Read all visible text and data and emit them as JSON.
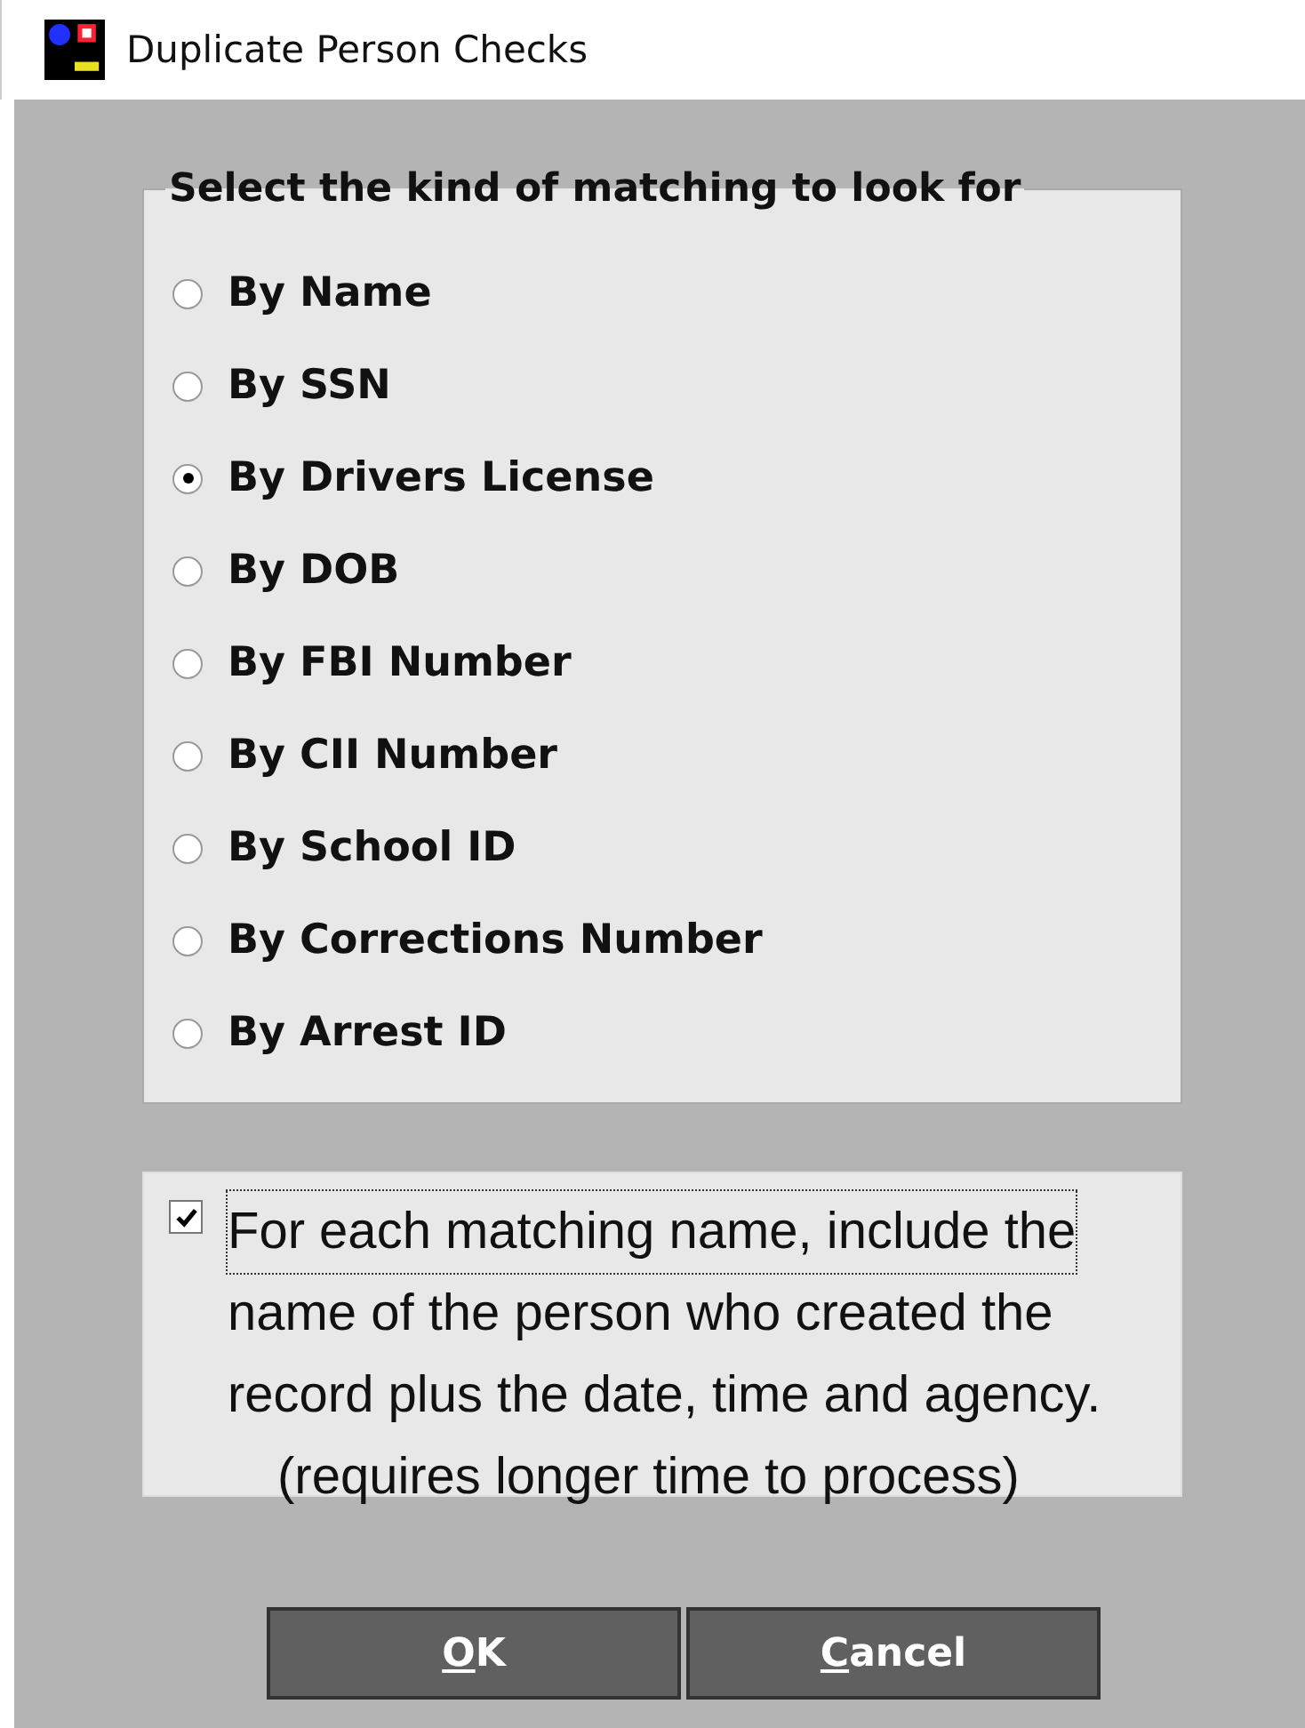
{
  "window": {
    "title": "Duplicate Person Checks"
  },
  "matching": {
    "legend": "Select the kind of matching to look for",
    "options": [
      {
        "label": "By Name",
        "selected": false
      },
      {
        "label": "By SSN",
        "selected": false
      },
      {
        "label": "By Drivers License",
        "selected": true
      },
      {
        "label": "By DOB",
        "selected": false
      },
      {
        "label": "By FBI Number",
        "selected": false
      },
      {
        "label": "By CII Number",
        "selected": false
      },
      {
        "label": "By School ID",
        "selected": false
      },
      {
        "label": "By Corrections Number",
        "selected": false
      },
      {
        "label": "By Arrest ID",
        "selected": false
      }
    ]
  },
  "include_creator": {
    "checked": true,
    "lines": [
      "For each matching name, include the",
      "name of the person who created the",
      "record plus the date, time and agency."
    ],
    "note": "(requires longer time to process)"
  },
  "buttons": [
    {
      "label": "OK"
    },
    {
      "label": "Cancel"
    }
  ]
}
